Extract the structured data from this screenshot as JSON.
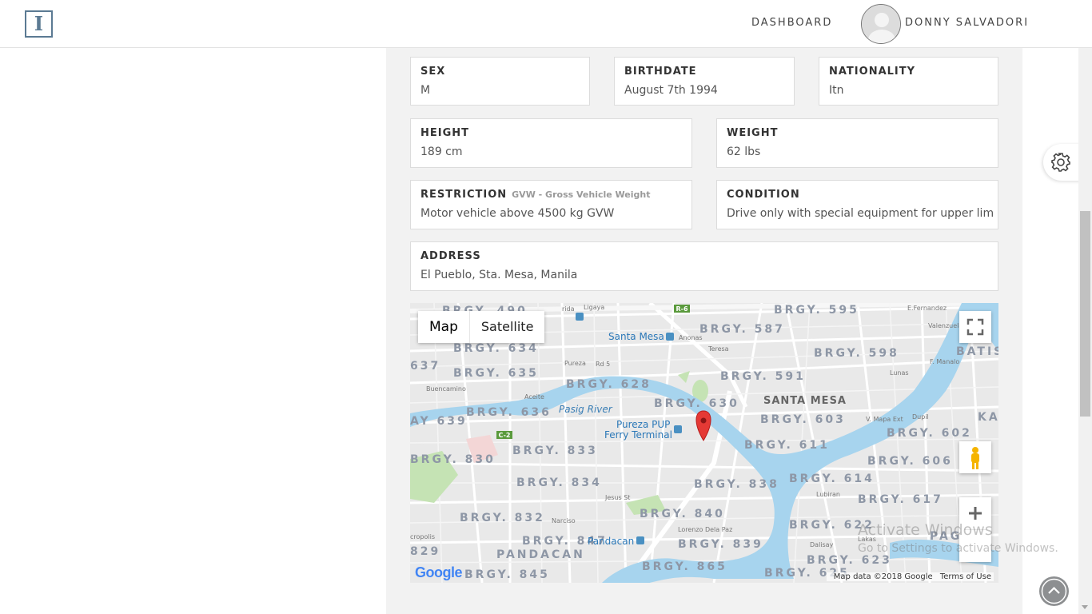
{
  "header": {
    "logo_letter": "I",
    "nav_dashboard": "DASHBOARD",
    "user_name": "DONNY SALVADORI"
  },
  "profile": {
    "sex": {
      "label": "SEX",
      "value": "M"
    },
    "birthdate": {
      "label": "BIRTHDATE",
      "value": "August 7th 1994"
    },
    "nationality": {
      "label": "NATIONALITY",
      "value": "Itn"
    },
    "height": {
      "label": "HEIGHT",
      "value": "189 cm"
    },
    "weight": {
      "label": "WEIGHT",
      "value": "62 lbs"
    },
    "restriction": {
      "label": "RESTRICTION",
      "note": "GVW - Gross Vehicle Weight",
      "value": "Motor vehicle above 4500 kg GVW"
    },
    "condition": {
      "label": "CONDITION",
      "value": "Drive only with special equipment for upper lim"
    },
    "address": {
      "label": "ADDRESS",
      "value": "El Pueblo, Sta. Mesa, Manila"
    }
  },
  "map": {
    "type_map": "Map",
    "type_satellite": "Satellite",
    "labels": {
      "brgy_490": "BRGY. 490",
      "brgy_595": "BRGY. 595",
      "brgy_587": "BRGY. 587",
      "brgy_634": "BRGY. 634",
      "brgy_598": "BRGY. 598",
      "batis": "BATIS",
      "brgy_637": "637",
      "brgy_635": "BRGY. 635",
      "brgy_628": "BRGY. 628",
      "brgy_591": "BRGY. 591",
      "santa_mesa": "SANTA MESA",
      "brgy_630": "BRGY. 630",
      "brgy_636": "BRGY. 636",
      "brgy_639": "AY 639",
      "brgy_603": "BRGY. 603",
      "ka": "KA",
      "brgy_602": "BRGY. 602",
      "brgy_611": "BRGY. 611",
      "brgy_830": "BRGY. 830",
      "brgy_833": "BRGY. 833",
      "brgy_606": "BRGY. 606",
      "brgy_834": "BRGY. 834",
      "brgy_838": "BRGY. 838",
      "brgy_614": "BRGY. 614",
      "brgy_617": "BRGY. 617",
      "brgy_840": "BRGY. 840",
      "brgy_832": "BRGY. 832",
      "brgy_622": "BRGY. 622",
      "brgy_847": "BRGY. 847",
      "pag": "PAG",
      "brgy_829": "829",
      "pandacan": "PANDACAN",
      "brgy_839": "BRGY. 839",
      "brgy_623": "BRGY. 623",
      "brgy_865": "BRGY. 865",
      "brgy_845": "BRGY. 845",
      "brgy_625": "BRGY. 625",
      "santa_mesa_station": "Santa Mesa",
      "pasig_river": "Pasig River",
      "pureza_pup": "Pureza PUP",
      "ferry_terminal": "Ferry Terminal",
      "pandacan_station": "Pandacan",
      "ligaya": "Ligaya",
      "anonas": "Anonas",
      "teresa": "Teresa",
      "pureza": "Pureza",
      "rd5": "Rd 5",
      "buencamino": "Buencamino",
      "aceite": "Aceite",
      "jesus_st": "Jesus St",
      "lorenzo": "Lorenzo Dela Paz",
      "narciso": "Narciso",
      "lubiran": "Lubiran",
      "f_manalo": "F. Manalo",
      "e_fernandez": "E.Fernandez",
      "valenzuela": "Valenzuela",
      "lunas": "Lunas",
      "v_mapa": "V. Mapa Ext",
      "dupil": "Dupil",
      "r6": "R-6",
      "c2": "C-2",
      "acropolis": "cropolis",
      "rida": "rida",
      "lakas": "Lakas",
      "dalisay": "Dalisay"
    },
    "google": "Google",
    "attribution": "Map data ©2018 Google",
    "terms": "Terms of Use"
  },
  "watermark": {
    "title": "Activate Windows",
    "subtitle": "Go to Settings to activate Windows."
  },
  "colors": {
    "river": "#a7d4ee",
    "map_bg": "#e9e9e9",
    "park": "#c5e3b4",
    "pin": "#e53935",
    "panel_bg": "#f2f2f2",
    "brand": "#5b7a93"
  }
}
